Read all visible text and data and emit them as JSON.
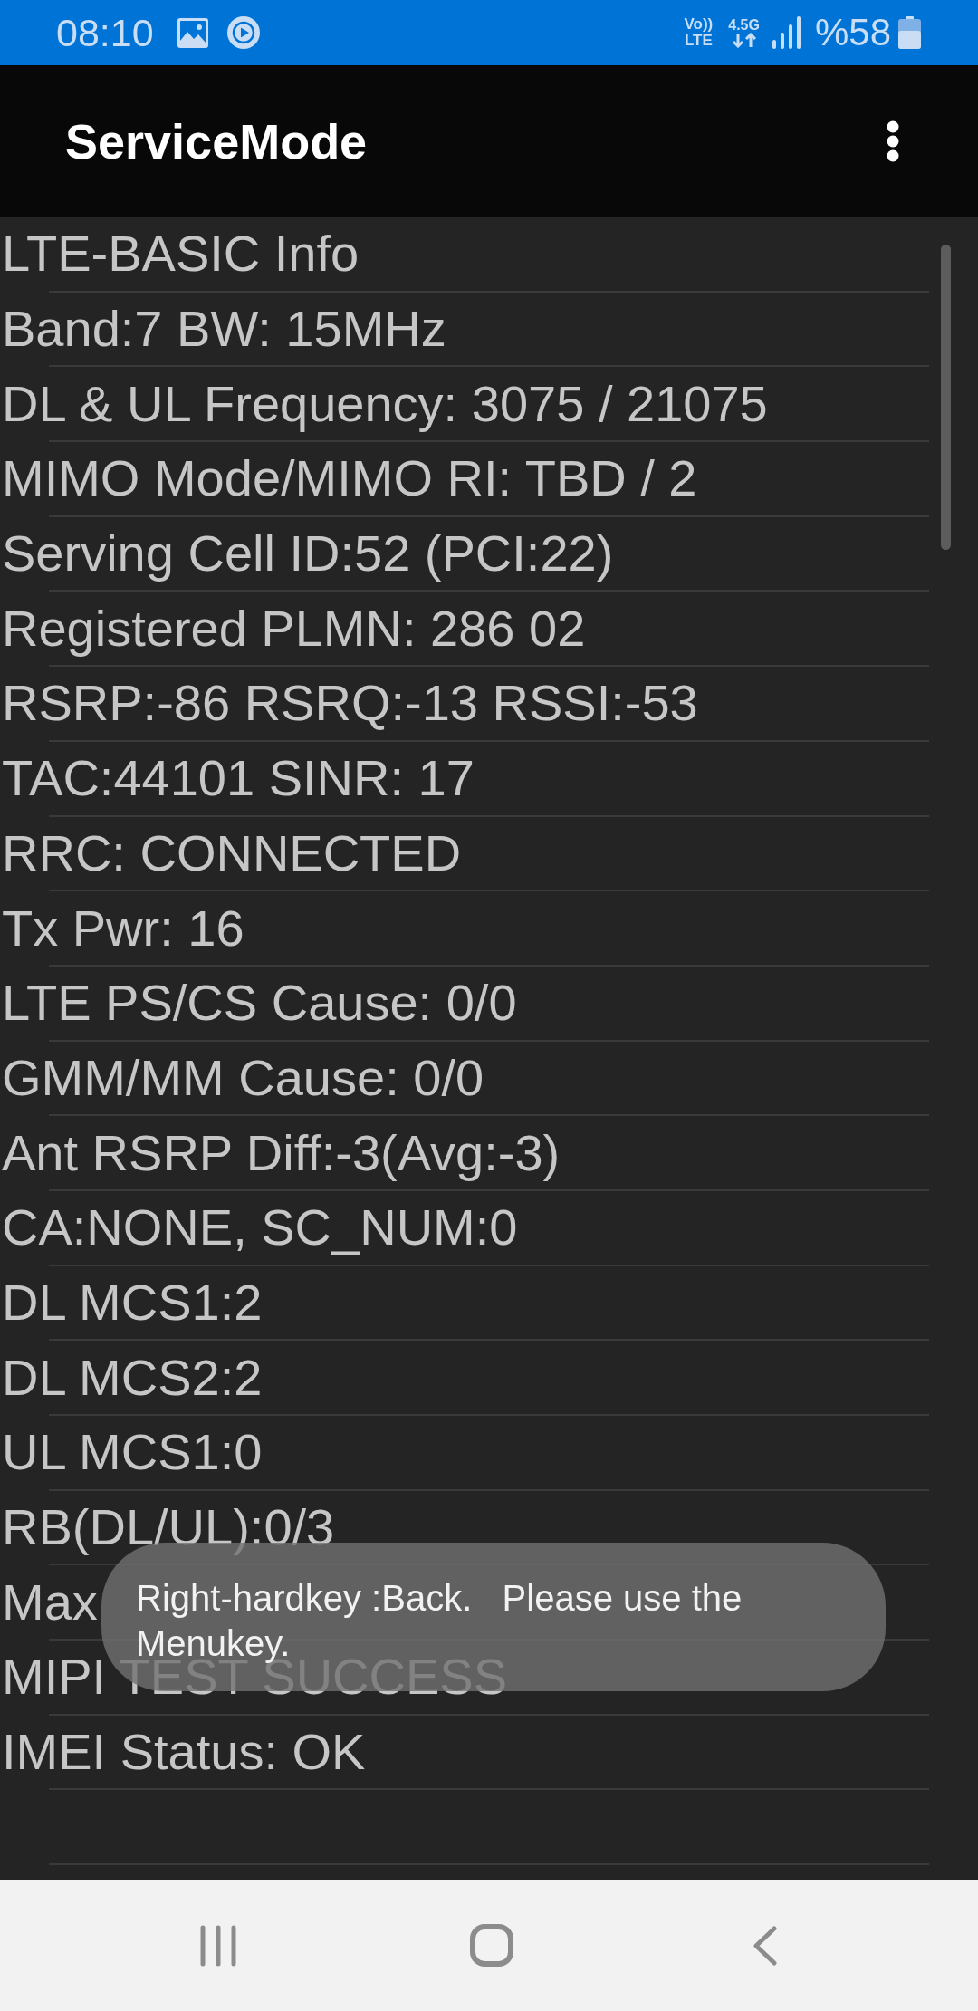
{
  "status_bar": {
    "time": "08:10",
    "volte": "Vo)) LTE",
    "network_type": "4.5G",
    "battery": "%58"
  },
  "app_bar": {
    "title": "ServiceMode"
  },
  "info_lines": [
    "LTE-BASIC Info",
    "Band:7 BW: 15MHz",
    "DL & UL Frequency: 3075 / 21075",
    "MIMO Mode/MIMO RI: TBD / 2",
    "Serving Cell ID:52 (PCI:22)",
    "Registered PLMN: 286 02",
    "RSRP:-86 RSRQ:-13 RSSI:-53",
    "TAC:44101 SINR: 17",
    "RRC: CONNECTED",
    "Tx Pwr: 16",
    "LTE PS/CS Cause: 0/0",
    "GMM/MM Cause: 0/0",
    "Ant RSRP Diff:-3(Avg:-3)",
    "CA:NONE, SC_NUM:0",
    "DL MCS1:2",
    "DL MCS2:2",
    "UL MCS1:0",
    "RB(DL/UL):0/3",
    "Max",
    "MIPI TEST SUCCESS",
    "IMEI Status: OK"
  ],
  "toast": {
    "text": "Right-hardkey :Back.   Please use the Menukey."
  }
}
